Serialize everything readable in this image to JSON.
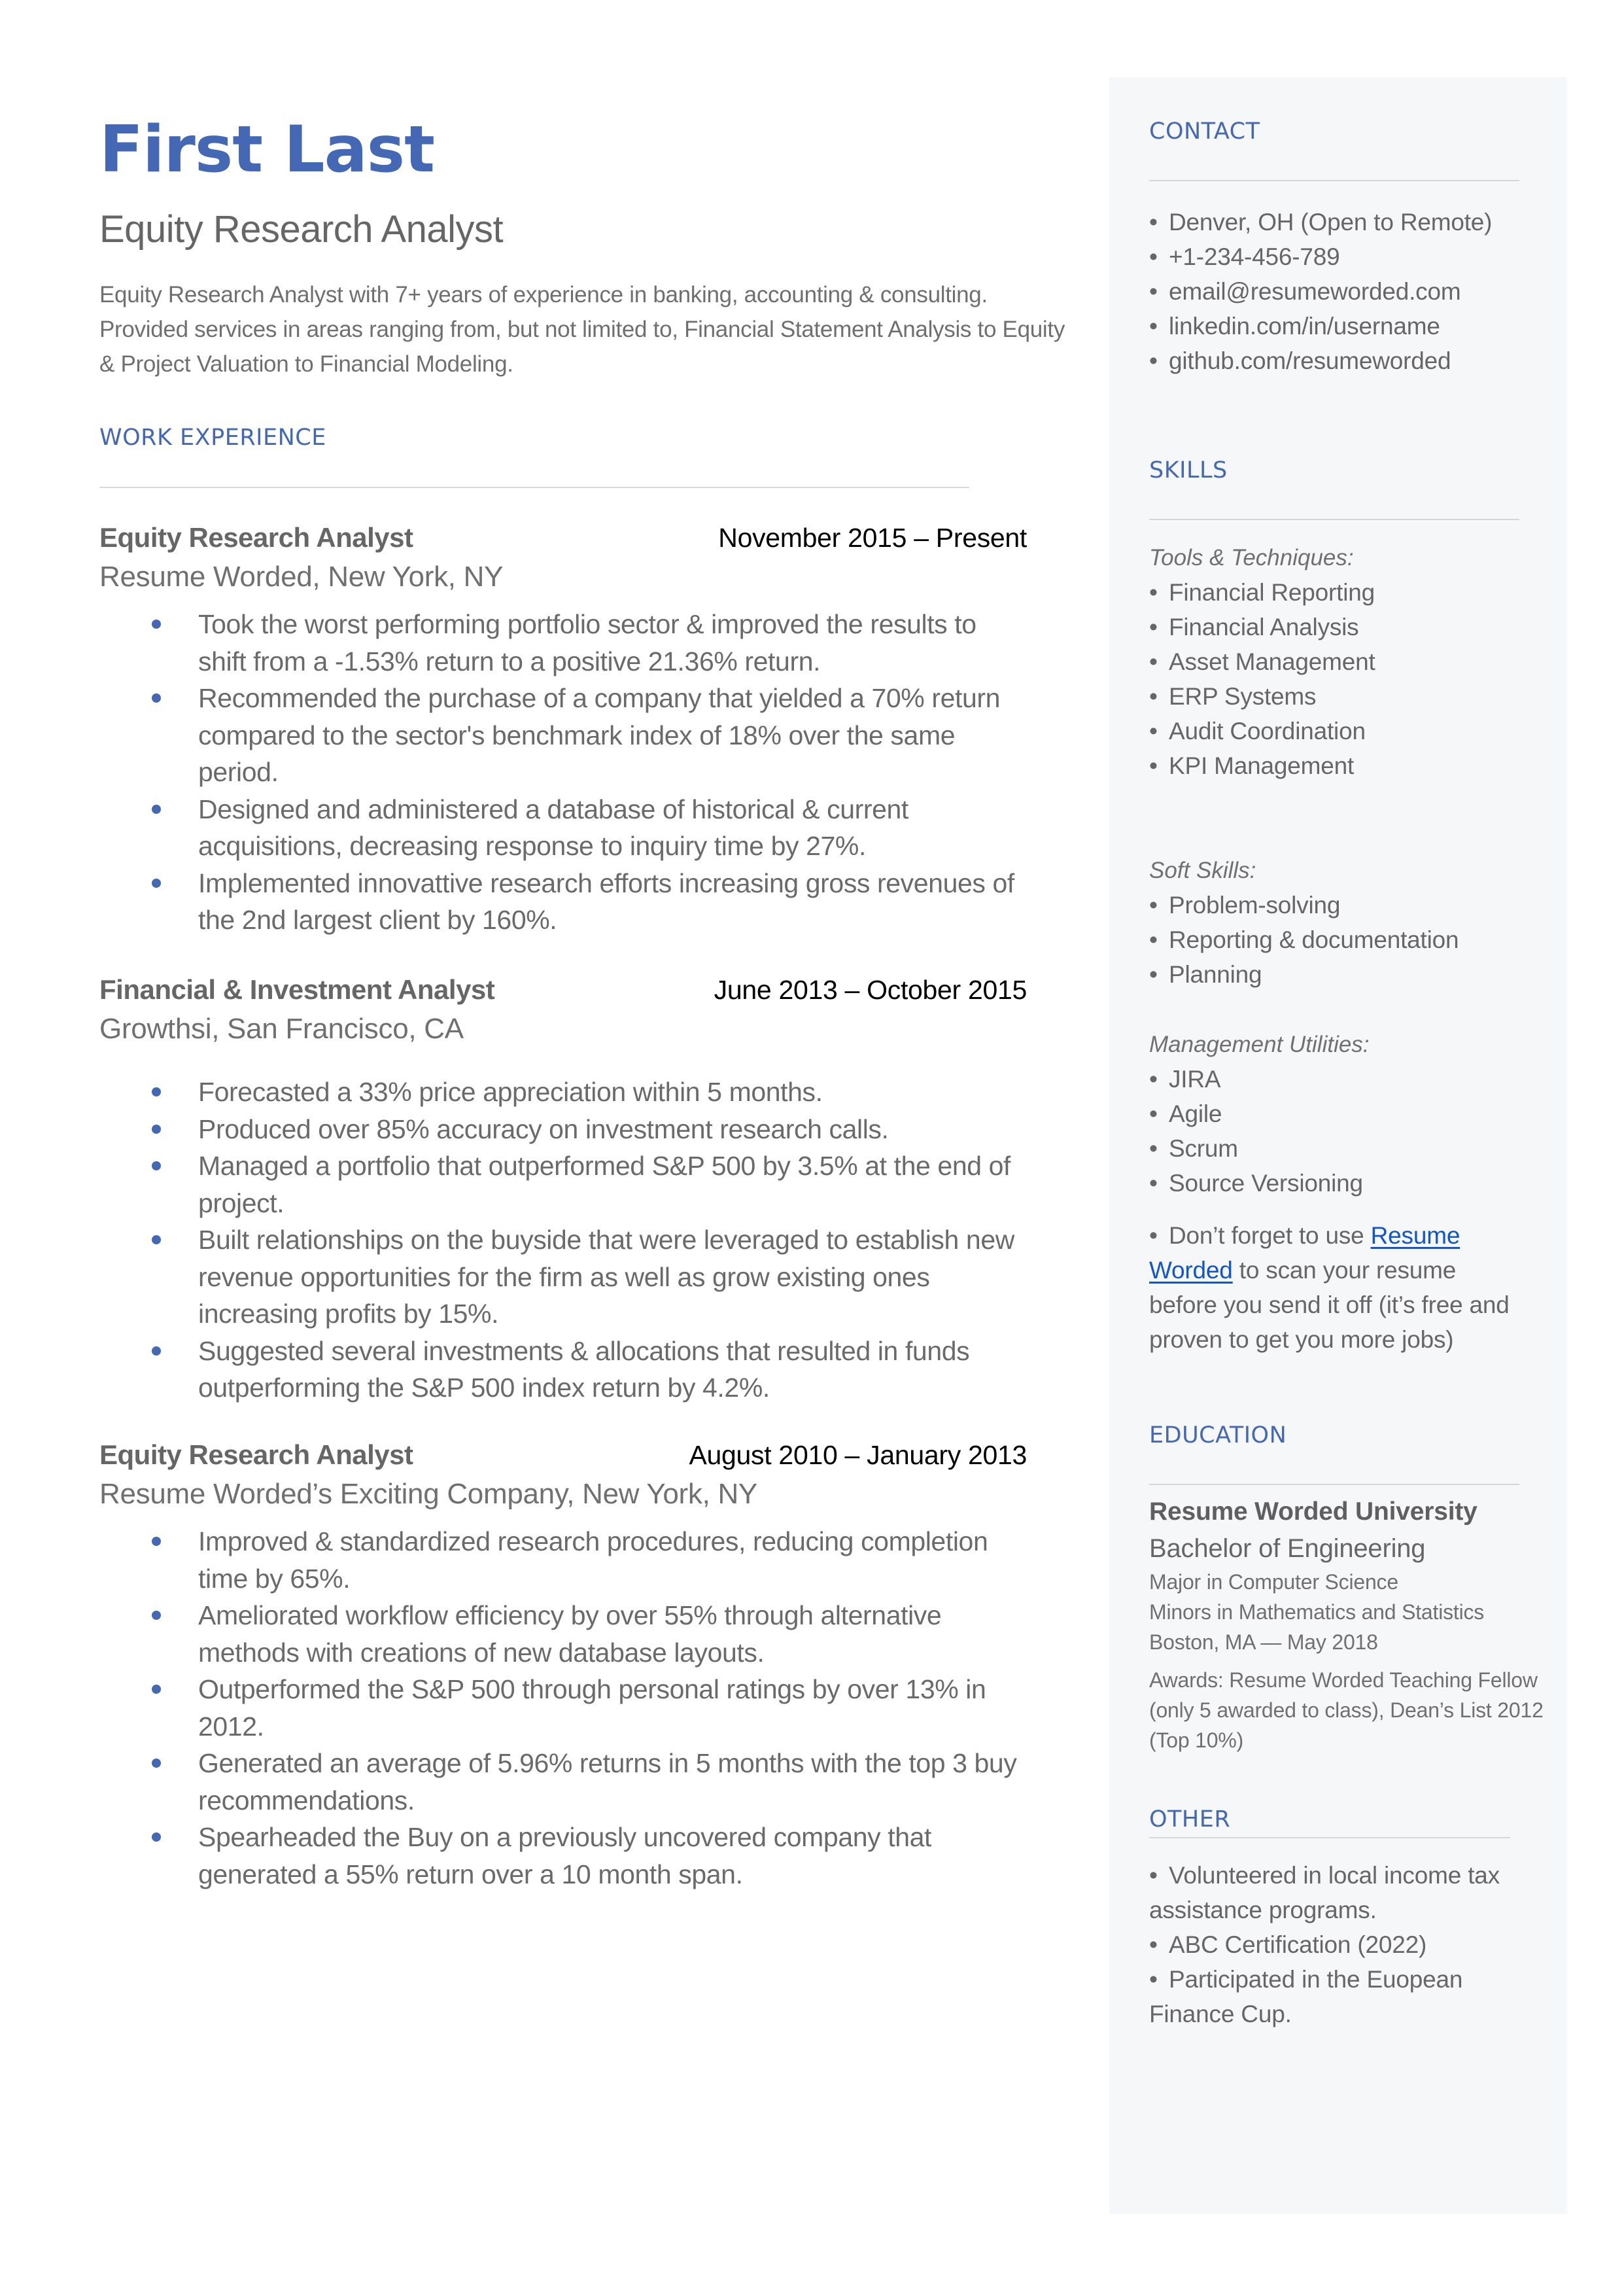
{
  "header": {
    "name": "First Last",
    "title": "Equity Research Analyst",
    "summary": "Equity Research Analyst with 7+ years of experience in banking, accounting & consulting. Provided services in areas ranging from, but not limited to, Financial Statement Analysis to Equity & Project Valuation to Financial Modeling."
  },
  "colors": {
    "accent": "#4468b4",
    "text": "#666666",
    "sidebar_bg": "#f6f7f9",
    "link": "#1155cc"
  },
  "work_experience": {
    "heading": "WORK EXPERIENCE",
    "jobs": [
      {
        "title": "Equity Research Analyst",
        "dates": "November 2015 – Present",
        "company": "Resume Worded, New York, NY",
        "bullets": [
          "Took the worst performing portfolio sector & improved the results to shift from a -1.53% return to a positive 21.36% return.",
          "Recommended the purchase of a company that yielded a 70% return compared to the sector's benchmark index of 18% over the same period.",
          "Designed and administered a database of historical & current acquisitions, decreasing response to inquiry time by 27%.",
          "Implemented innovattive research efforts increasing gross revenues of the 2nd largest client by 160%."
        ]
      },
      {
        "title": "Financial & Investment Analyst",
        "dates": "June 2013 – October 2015",
        "company": "Growthsi, San Francisco, CA",
        "bullets": [
          "Forecasted a 33% price appreciation within 5 months.",
          "Produced over 85% accuracy on investment research calls.",
          "Managed a portfolio that outperformed S&P 500 by 3.5% at the end of project.",
          "Built relationships on the buyside that were leveraged to establish new revenue opportunities for the firm as well as grow existing ones increasing profits by 15%.",
          "Suggested several investments & allocations that resulted in funds outperforming the S&P 500 index return by 4.2%."
        ]
      },
      {
        "title": "Equity Research Analyst",
        "dates": "August 2010 – January 2013",
        "company": "Resume Worded’s Exciting Company, New York, NY",
        "bullets": [
          "Improved & standardized research procedures, reducing completion time by 65%.",
          "Ameliorated workflow efficiency by over 55% through alternative methods with creations of new database layouts.",
          "Outperformed the S&P 500 through personal ratings by over 13% in 2012.",
          "Generated an average of 5.96% returns in 5 months with the top 3 buy recommendations.",
          "Spearheaded the Buy on a previously uncovered company that generated a 55% return over a 10 month span."
        ]
      }
    ]
  },
  "sidebar": {
    "bullet_glyph": "•",
    "contact": {
      "heading": "CONTACT",
      "items": [
        "Denver, OH (Open to Remote)",
        "+1-234-456-789",
        "email@resumeworded.com",
        "linkedin.com/in/username",
        "github.com/resumeworded"
      ]
    },
    "skills": {
      "heading": "SKILLS",
      "groups": [
        {
          "label": "Tools & Techniques:",
          "items": [
            "Financial Reporting",
            "Financial Analysis",
            "Asset Management",
            "ERP Systems",
            "Audit Coordination",
            "KPI Management"
          ]
        },
        {
          "label": "Soft Skills:",
          "items": [
            "Problem-solving",
            "Reporting & documentation",
            "Planning"
          ]
        },
        {
          "label": "Management Utilities:",
          "items": [
            "JIRA",
            "Agile",
            "Scrum",
            "Source Versioning"
          ]
        }
      ],
      "tip": {
        "before": "Don’t forget to use ",
        "link": "Resume Worded",
        "after": " to scan your resume before you send it off (it’s free and proven to get you more jobs)"
      }
    },
    "education": {
      "heading": "EDUCATION",
      "school": "Resume Worded University",
      "degree": "Bachelor of Engineering",
      "major": "Major in Computer Science",
      "minors": "Minors in Mathematics and Statistics",
      "location_date": "Boston, MA — May 2018",
      "awards": "Awards: Resume Worded Teaching Fellow (only 5 awarded to class), Dean’s List 2012 (Top 10%)"
    },
    "other": {
      "heading": "OTHER",
      "items": [
        "Volunteered in local income tax assistance programs.",
        "ABC Certification (2022)",
        "Participated in the Euopean Finance Cup."
      ]
    }
  }
}
